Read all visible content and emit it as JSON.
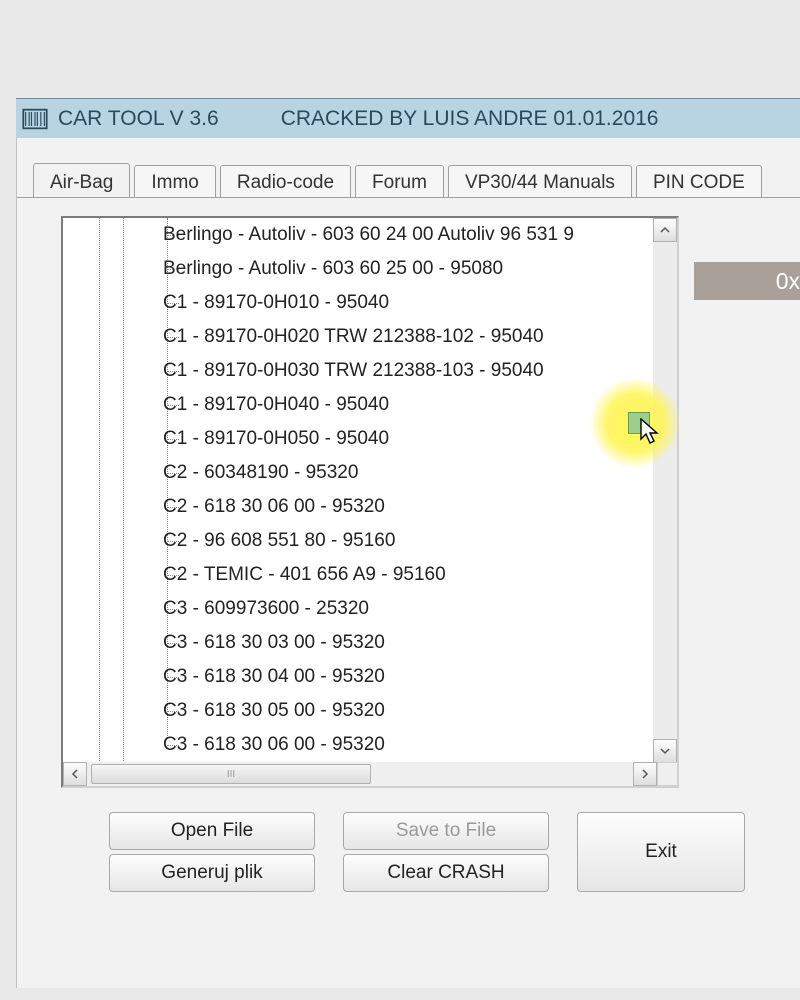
{
  "title": {
    "app": "CAR TOOL V 3.6",
    "credit": "CRACKED BY LUIS ANDRE 01.01.2016"
  },
  "tabs": [
    {
      "label": "Air-Bag",
      "active": true
    },
    {
      "label": "Immo",
      "active": false
    },
    {
      "label": "Radio-code",
      "active": false
    },
    {
      "label": "Forum",
      "active": false
    },
    {
      "label": "VP30/44 Manuals",
      "active": false
    },
    {
      "label": "PIN CODE",
      "active": false
    }
  ],
  "tree_items": [
    "Berlingo - Autoliv - 603 60 24 00 Autoliv 96 531 9",
    "Berlingo - Autoliv - 603 60 25 00 - 95080",
    "C1 - 89170-0H010 - 95040",
    "C1 - 89170-0H020 TRW 212388-102 - 95040",
    "C1 - 89170-0H030 TRW 212388-103 - 95040",
    "C1 - 89170-0H040 - 95040",
    "C1 - 89170-0H050 - 95040",
    "C2 - 60348190 - 95320",
    "C2 - 618 30 06 00 - 95320",
    "C2 - 96 608 551 80 - 95160",
    "C2 - TEMIC - 401 656 A9 - 95160",
    "C3 - 609973600 - 25320",
    "C3 - 618 30 03 00 - 95320",
    "C3 - 618 30 04 00 - 95320",
    "C3 - 618 30 05 00 - 95320",
    "C3 - 618 30 06 00 - 95320"
  ],
  "side_value": "0x",
  "buttons": {
    "open_file": "Open File",
    "generuj": "Generuj plik",
    "save_to_file": "Save to File",
    "clear_crash": "Clear CRASH",
    "exit": "Exit"
  },
  "hscroll_grip": "III"
}
